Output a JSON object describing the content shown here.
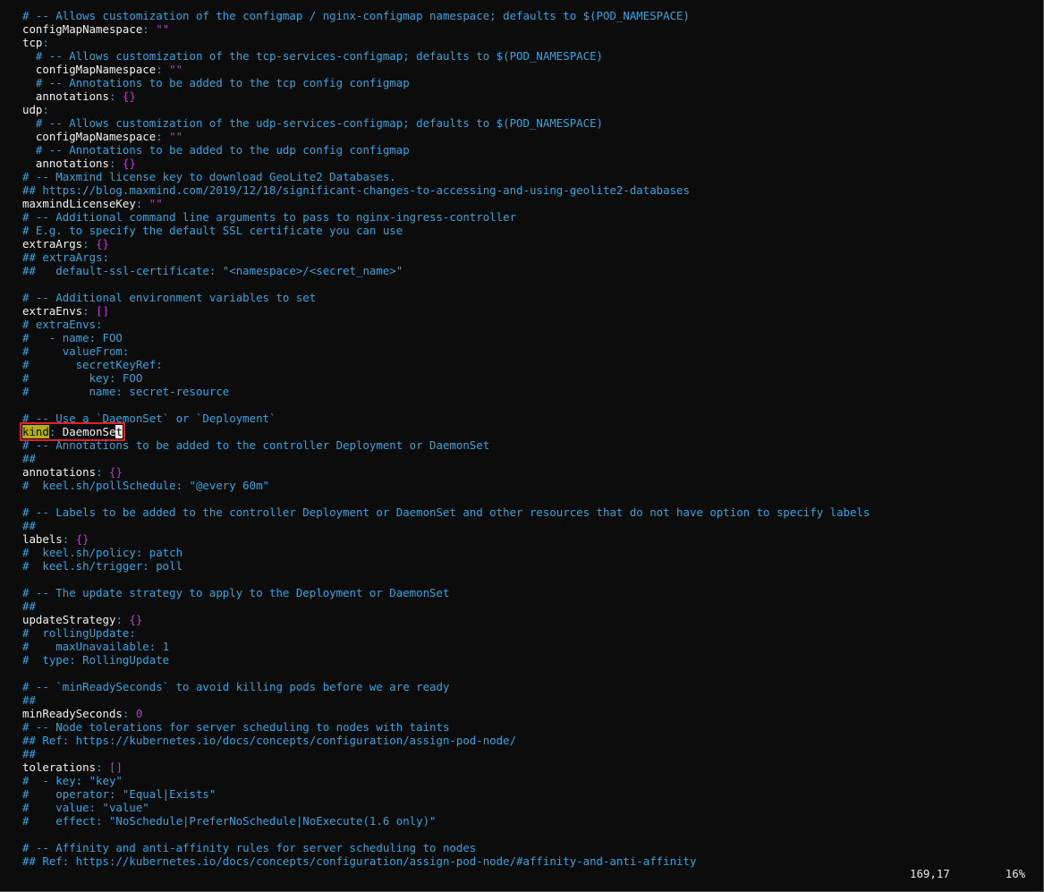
{
  "editor": {
    "lines": [
      [
        {
          "t": "# -- Allows customization of the configmap / nginx-configmap namespace; defaults to $(POD_NAMESPACE)",
          "c": "c"
        }
      ],
      [
        {
          "t": "configMapNamespace",
          "c": "k"
        },
        {
          "t": ": ",
          "c": "c"
        },
        {
          "t": "\"\"",
          "c": "s"
        }
      ],
      [
        {
          "t": "tcp",
          "c": "k"
        },
        {
          "t": ":",
          "c": "c"
        }
      ],
      [
        {
          "t": "  # -- Allows customization of the tcp-services-configmap; defaults to $(POD_NAMESPACE)",
          "c": "c"
        }
      ],
      [
        {
          "t": "  configMapNamespace",
          "c": "k"
        },
        {
          "t": ": ",
          "c": "c"
        },
        {
          "t": "\"\"",
          "c": "s"
        }
      ],
      [
        {
          "t": "  # -- Annotations to be added to the tcp config configmap",
          "c": "c"
        }
      ],
      [
        {
          "t": "  annotations",
          "c": "k"
        },
        {
          "t": ": ",
          "c": "c"
        },
        {
          "t": "{}",
          "c": "n"
        }
      ],
      [
        {
          "t": "udp",
          "c": "k"
        },
        {
          "t": ":",
          "c": "c"
        }
      ],
      [
        {
          "t": "  # -- Allows customization of the udp-services-configmap; defaults to $(POD_NAMESPACE)",
          "c": "c"
        }
      ],
      [
        {
          "t": "  configMapNamespace",
          "c": "k"
        },
        {
          "t": ": ",
          "c": "c"
        },
        {
          "t": "\"\"",
          "c": "s"
        }
      ],
      [
        {
          "t": "  # -- Annotations to be added to the udp config configmap",
          "c": "c"
        }
      ],
      [
        {
          "t": "  annotations",
          "c": "k"
        },
        {
          "t": ": ",
          "c": "c"
        },
        {
          "t": "{}",
          "c": "n"
        }
      ],
      [
        {
          "t": "# -- Maxmind license key to download GeoLite2 Databases.",
          "c": "c"
        }
      ],
      [
        {
          "t": "## https://blog.maxmind.com/2019/12/18/significant-changes-to-accessing-and-using-geolite2-databases",
          "c": "c"
        }
      ],
      [
        {
          "t": "maxmindLicenseKey",
          "c": "k"
        },
        {
          "t": ": ",
          "c": "c"
        },
        {
          "t": "\"\"",
          "c": "s"
        }
      ],
      [
        {
          "t": "# -- Additional command line arguments to pass to nginx-ingress-controller",
          "c": "c"
        }
      ],
      [
        {
          "t": "# E.g. to specify the default SSL certificate you can use",
          "c": "c"
        }
      ],
      [
        {
          "t": "extraArgs",
          "c": "k"
        },
        {
          "t": ": ",
          "c": "c"
        },
        {
          "t": "{}",
          "c": "n"
        }
      ],
      [
        {
          "t": "## extraArgs:",
          "c": "c"
        }
      ],
      [
        {
          "t": "##   default-ssl-certificate: \"<namespace>/<secret_name>\"",
          "c": "c"
        }
      ],
      [],
      [
        {
          "t": "# -- Additional environment variables to set",
          "c": "c"
        }
      ],
      [
        {
          "t": "extraEnvs",
          "c": "k"
        },
        {
          "t": ": ",
          "c": "c"
        },
        {
          "t": "[]",
          "c": "n"
        }
      ],
      [
        {
          "t": "# extraEnvs:",
          "c": "c"
        }
      ],
      [
        {
          "t": "#   - name: FOO",
          "c": "c"
        }
      ],
      [
        {
          "t": "#     valueFrom:",
          "c": "c"
        }
      ],
      [
        {
          "t": "#       secretKeyRef:",
          "c": "c"
        }
      ],
      [
        {
          "t": "#         key: FOO",
          "c": "c"
        }
      ],
      [
        {
          "t": "#         name: secret-resource",
          "c": "c"
        }
      ],
      [],
      [
        {
          "t": "# -- Use a `DaemonSet` or `Deployment`",
          "c": "c"
        }
      ],
      [
        {
          "t": "kind",
          "c": "hl",
          "box": true
        },
        {
          "t": ": ",
          "c": "c",
          "box": true
        },
        {
          "t": "DaemonSe",
          "c": "k",
          "box": true
        },
        {
          "t": "t",
          "c": "cur",
          "box": true
        }
      ],
      [
        {
          "t": "# -- Annotations to be added to the controller Deployment or DaemonSet",
          "c": "c"
        }
      ],
      [
        {
          "t": "##",
          "c": "c"
        }
      ],
      [
        {
          "t": "annotations",
          "c": "k"
        },
        {
          "t": ": ",
          "c": "c"
        },
        {
          "t": "{}",
          "c": "n"
        }
      ],
      [
        {
          "t": "#  keel.sh/pollSchedule: \"@every 60m\"",
          "c": "c"
        }
      ],
      [],
      [
        {
          "t": "# -- Labels to be added to the controller Deployment or DaemonSet and other resources that do not have option to specify labels",
          "c": "c"
        }
      ],
      [
        {
          "t": "##",
          "c": "c"
        }
      ],
      [
        {
          "t": "labels",
          "c": "k"
        },
        {
          "t": ": ",
          "c": "c"
        },
        {
          "t": "{}",
          "c": "n"
        }
      ],
      [
        {
          "t": "#  keel.sh/policy: patch",
          "c": "c"
        }
      ],
      [
        {
          "t": "#  keel.sh/trigger: poll",
          "c": "c"
        }
      ],
      [],
      [
        {
          "t": "# -- The update strategy to apply to the Deployment or DaemonSet",
          "c": "c"
        }
      ],
      [
        {
          "t": "##",
          "c": "c"
        }
      ],
      [
        {
          "t": "updateStrategy",
          "c": "k"
        },
        {
          "t": ": ",
          "c": "c"
        },
        {
          "t": "{}",
          "c": "n"
        }
      ],
      [
        {
          "t": "#  rollingUpdate:",
          "c": "c"
        }
      ],
      [
        {
          "t": "#    maxUnavailable: 1",
          "c": "c"
        }
      ],
      [
        {
          "t": "#  type: RollingUpdate",
          "c": "c"
        }
      ],
      [],
      [
        {
          "t": "# -- `minReadySeconds` to avoid killing pods before we are ready",
          "c": "c"
        }
      ],
      [
        {
          "t": "##",
          "c": "c"
        }
      ],
      [
        {
          "t": "minReadySeconds",
          "c": "k"
        },
        {
          "t": ": ",
          "c": "c"
        },
        {
          "t": "0",
          "c": "n"
        }
      ],
      [
        {
          "t": "# -- Node tolerations for server scheduling to nodes with taints",
          "c": "c"
        }
      ],
      [
        {
          "t": "## Ref: https://kubernetes.io/docs/concepts/configuration/assign-pod-node/",
          "c": "c"
        }
      ],
      [
        {
          "t": "##",
          "c": "c"
        }
      ],
      [
        {
          "t": "tolerations",
          "c": "k"
        },
        {
          "t": ": ",
          "c": "c"
        },
        {
          "t": "[]",
          "c": "n"
        }
      ],
      [
        {
          "t": "#  - key: \"key\"",
          "c": "c"
        }
      ],
      [
        {
          "t": "#    operator: \"Equal|Exists\"",
          "c": "c"
        }
      ],
      [
        {
          "t": "#    value: \"value\"",
          "c": "c"
        }
      ],
      [
        {
          "t": "#    effect: \"NoSchedule|PreferNoSchedule|NoExecute(1.6 only)\"",
          "c": "c"
        }
      ],
      [],
      [
        {
          "t": "# -- Affinity and anti-affinity rules for server scheduling to nodes",
          "c": "c"
        }
      ],
      [
        {
          "t": "## Ref: https://kubernetes.io/docs/concepts/configuration/assign-pod-node/#affinity-and-anti-affinity",
          "c": "c"
        }
      ]
    ]
  },
  "status": {
    "position": "169,17",
    "percent": "16%"
  },
  "colors": {
    "background": "#0c0c0c",
    "key": "#f2f2f2",
    "comment": "#3aa3df",
    "value": "#c03ad4",
    "search_highlight": "#b5ae1c",
    "annotation_box": "#e0202a"
  }
}
